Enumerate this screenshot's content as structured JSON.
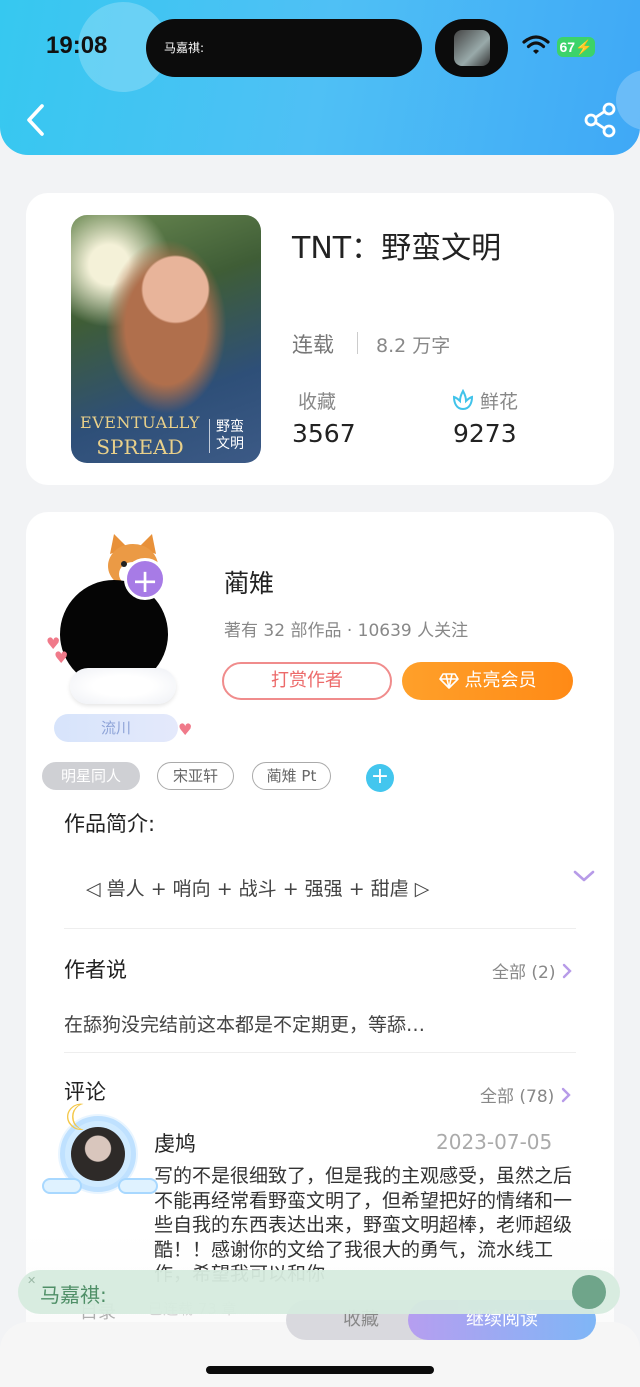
{
  "status": {
    "time": "19:08",
    "battery": "67",
    "island_text": "马嘉祺:"
  },
  "book": {
    "title": "TNT：野蛮文明",
    "status": "连载",
    "words": "8.2 万字",
    "cover_text_line1": "EVENTUALLY",
    "cover_text_line2": "SPREAD",
    "cover_cn": "野蛮文明",
    "collect_label": "收藏",
    "collect_count": "3567",
    "flower_label": "鲜花",
    "flower_count": "9273"
  },
  "author": {
    "name": "蔺雉",
    "meta": "著有 32 部作品 · 10639 人关注",
    "badge": "流川",
    "tip_button": "打赏作者",
    "vip_button": "点亮会员"
  },
  "tags": [
    "明星同人",
    "宋亚轩",
    "蔺雉 Pt"
  ],
  "intro": {
    "title": "作品简介:",
    "text": "◁ 兽人 + 哨向 + 战斗 + 强强 + 甜虐 ▷"
  },
  "author_says": {
    "title": "作者说",
    "more": "全部 (2)",
    "text": "在舔狗没完结前这本都是不定期更，等舔…"
  },
  "comments": {
    "title": "评论",
    "more": "全部 (78)",
    "items": [
      {
        "user": "虔鸠",
        "date": "2023-07-05",
        "text": "写的不是很细致了，但是我的主观感受，虽然之后不能再经常看野蛮文明了，但希望把好的情绪和一些自我的东西表达出来，野蛮文明超棒，老师超级酷！！感谢你的文给了我很大的勇气，流水线工作，希望我可以和你"
      }
    ]
  },
  "bottom_bar": {
    "toc": "目录",
    "updated": "已连载 73 章",
    "collect": "收藏",
    "read": "继续阅读"
  },
  "mini_player": {
    "text": "马嘉祺:"
  },
  "colors": {
    "header": "#3fc0f2",
    "accent_purple": "#a77be6",
    "vip_orange": "#ff9520",
    "tip_red": "#ec6a6a"
  }
}
